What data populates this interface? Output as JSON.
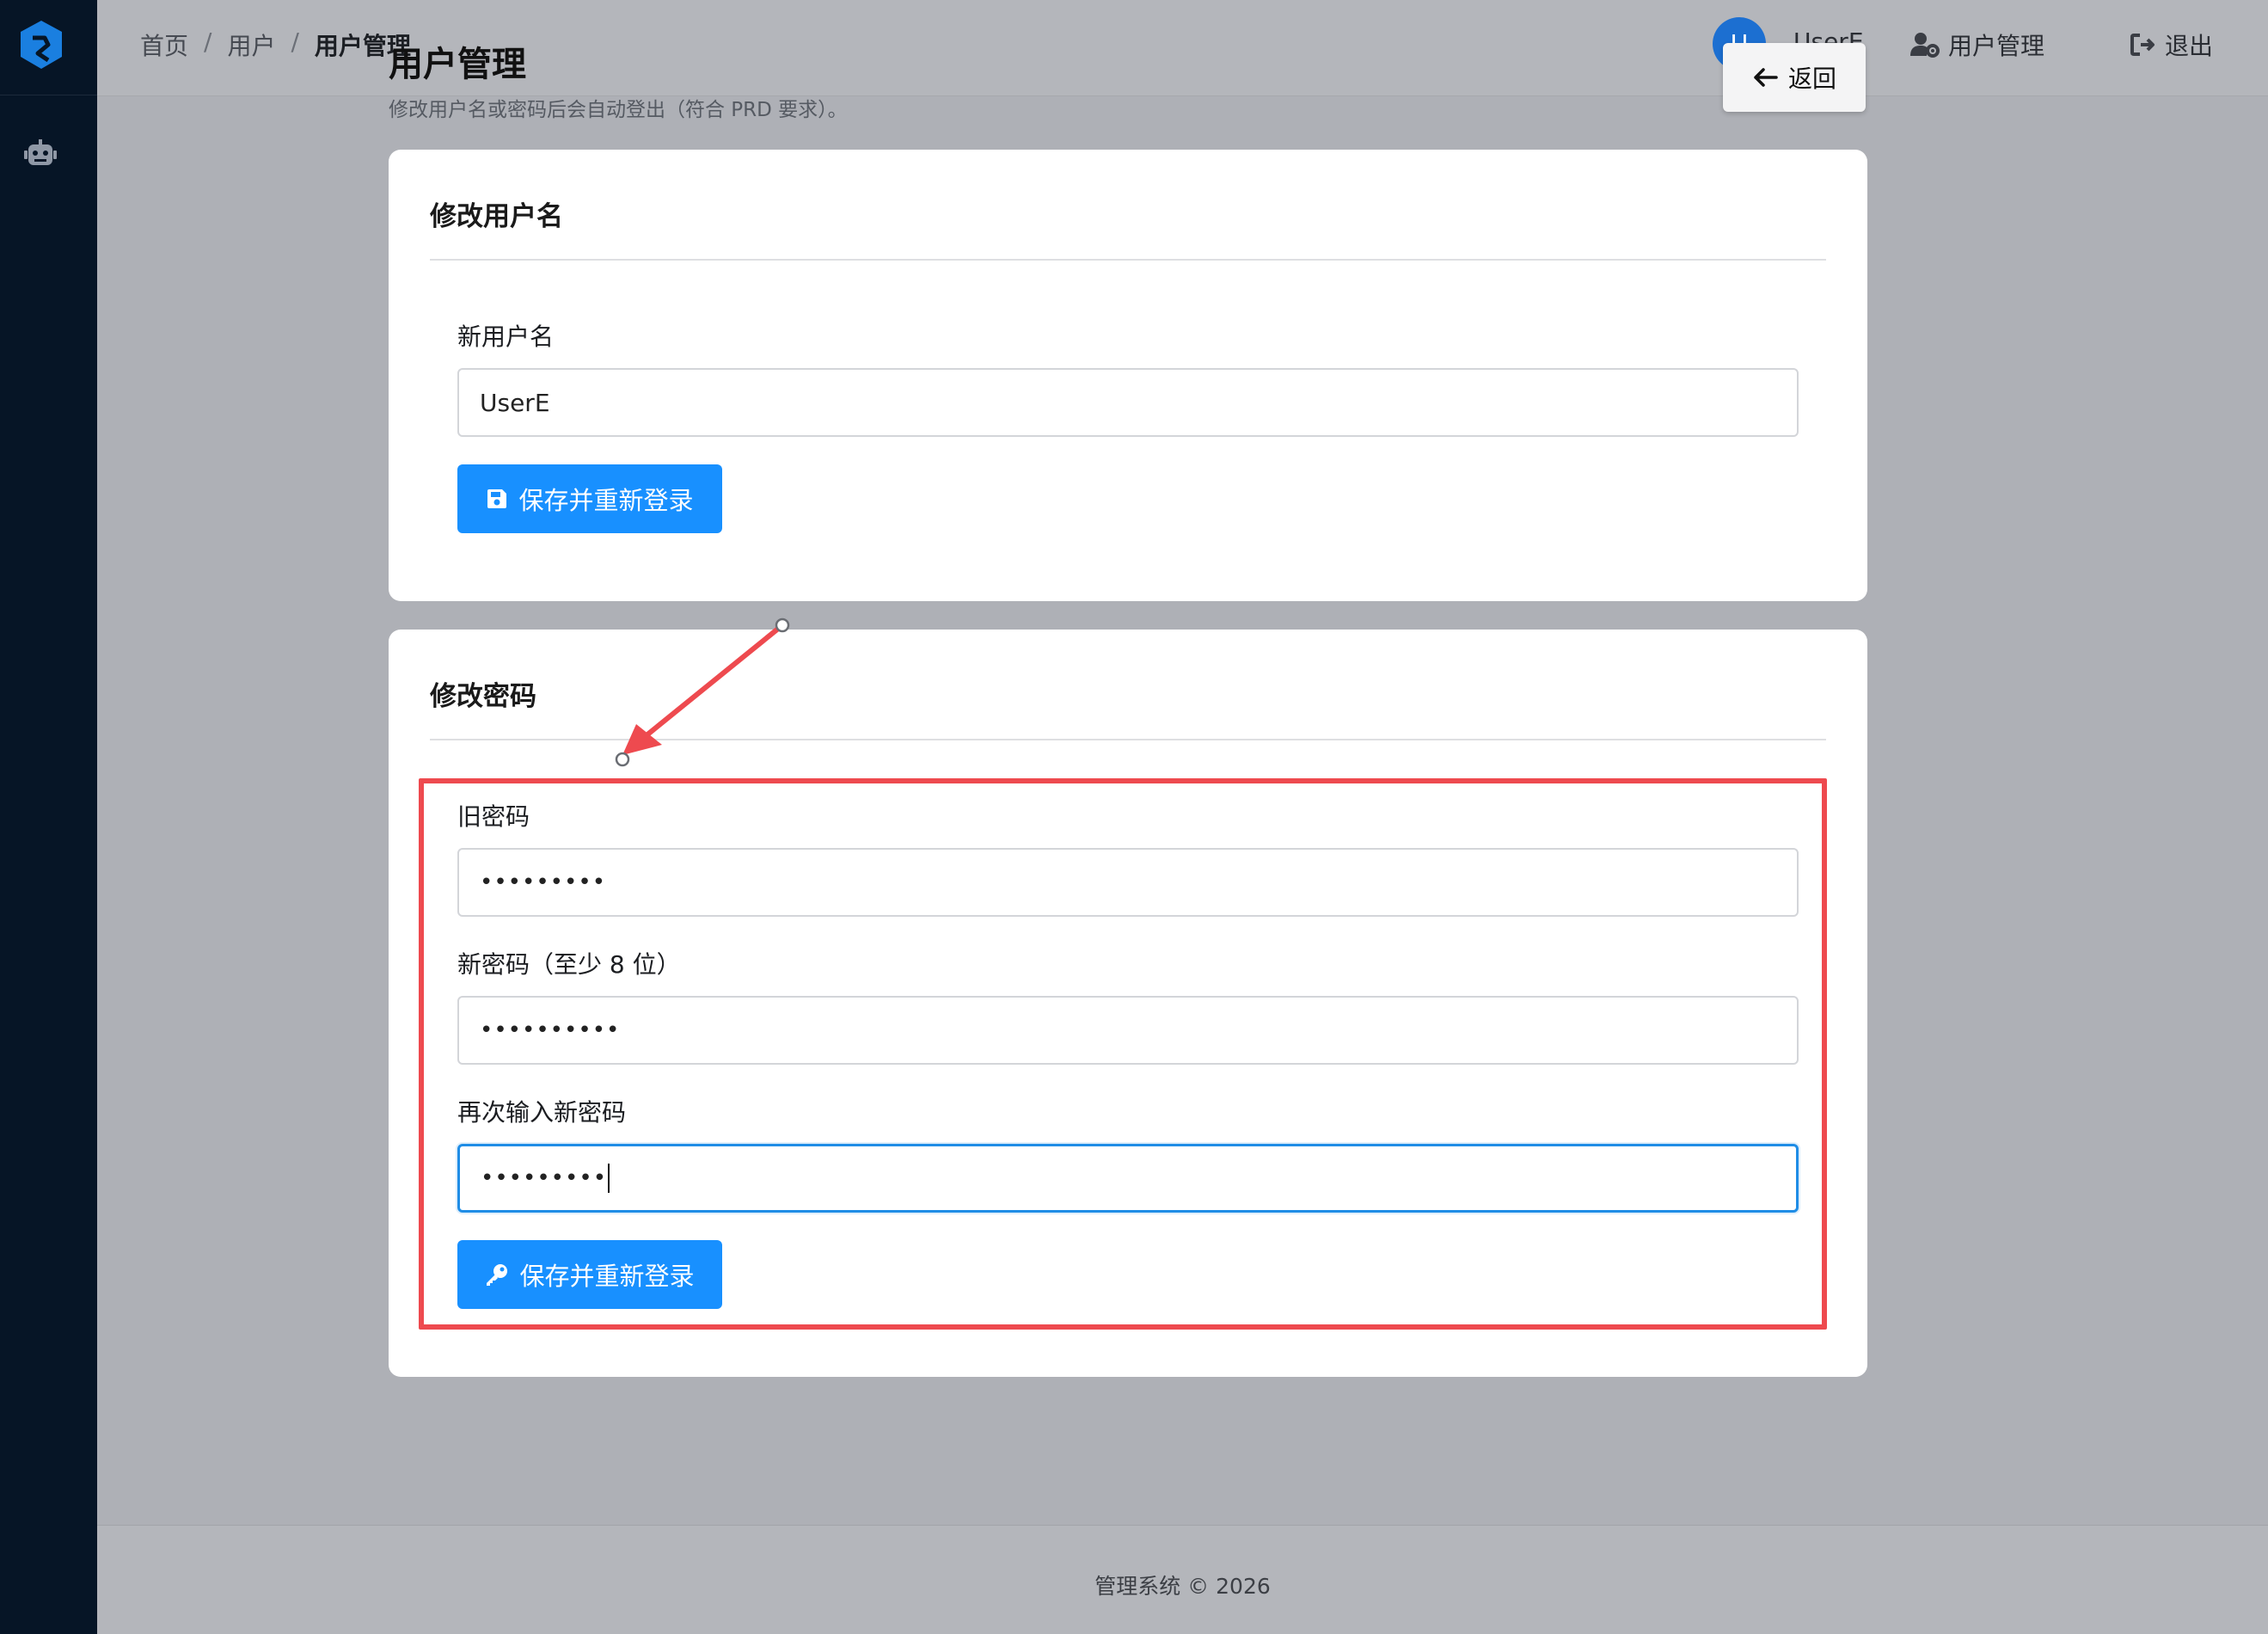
{
  "breadcrumb": [
    "首页",
    "用户",
    "用户管理"
  ],
  "header": {
    "avatar_letter": "U",
    "username": "UserE",
    "nav_user_manage": "用户管理",
    "nav_logout": "退出"
  },
  "page": {
    "title": "用户管理",
    "subtitle": "修改用户名或密码后会自动登出（符合 PRD 要求）。",
    "back_label": "返回"
  },
  "username_card": {
    "title": "修改用户名",
    "field_label": "新用户名",
    "field_value": "UserE",
    "submit_label": "保存并重新登录"
  },
  "password_card": {
    "title": "修改密码",
    "old_label": "旧密码",
    "old_value": "•••••••••",
    "new_label": "新密码（至少 8 位）",
    "new_value": "••••••••••",
    "confirm_label": "再次输入新密码",
    "confirm_value": "•••••••••",
    "submit_label": "保存并重新登录"
  },
  "footer": {
    "text": "管理系统 © 2026"
  },
  "colors": {
    "sidebar": "#061526",
    "primary": "#1890ff",
    "highlight": "#ee4a4f",
    "focus": "#1f8de6"
  },
  "icons": {
    "logo": "app-logo-icon",
    "robot": "robot-icon",
    "user_gear": "user-gear-icon",
    "logout": "logout-icon",
    "back": "arrow-left-icon",
    "save": "floppy-disk-icon",
    "key": "key-icon"
  }
}
